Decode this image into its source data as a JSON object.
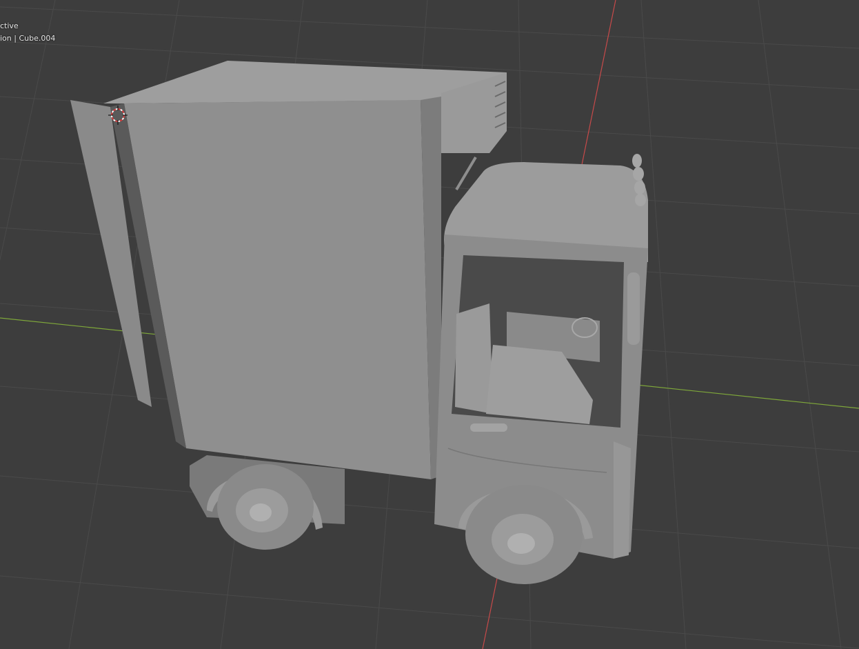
{
  "viewport": {
    "overlay_line1": "ctive",
    "overlay_line2": "ion | Cube.004",
    "colors": {
      "background": "#3d3d3d",
      "grid": "#4a4a4a",
      "axis_x": "#c84a4a",
      "axis_y": "#7fa83a",
      "model_base": "#8f8f8f",
      "model_light": "#a2a2a2",
      "model_dark": "#6e6e6e",
      "cursor": "#d23c3c"
    },
    "icons": {
      "cursor": "3d-cursor-icon"
    },
    "object_name": "Cube.004"
  }
}
